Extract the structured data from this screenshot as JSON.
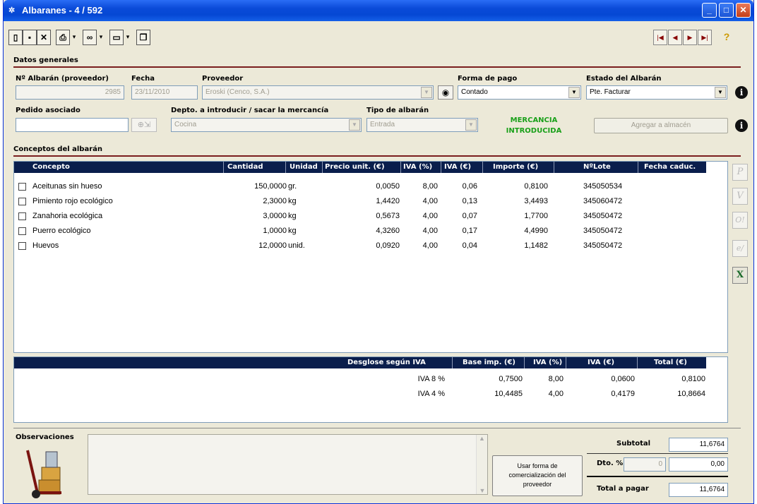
{
  "window": {
    "title": "Albaranes - 4 / 592"
  },
  "sections": {
    "general": "Datos generales",
    "concepts": "Conceptos del albarán"
  },
  "fields": {
    "albaran_label": "Nº Albarán (proveedor)",
    "albaran_value": "2985",
    "fecha_label": "Fecha",
    "fecha_value": "23/11/2010",
    "proveedor_label": "Proveedor",
    "proveedor_value": "Eroski (Cenco, S.A.)",
    "forma_pago_label": "Forma de pago",
    "forma_pago_value": "Contado",
    "estado_label": "Estado del Albarán",
    "estado_value": "Pte. Facturar",
    "pedido_label": "Pedido asociado",
    "pedido_value": "",
    "depto_label": "Depto. a introducir / sacar la mercancía",
    "depto_value": "Cocina",
    "tipo_label": "Tipo de albarán",
    "tipo_value": "Entrada",
    "status_line1": "MERCANCIA",
    "status_line2": "INTRODUCIDA",
    "agregar_button": "Agregar a almacén"
  },
  "concepts": {
    "headers": [
      "Concepto",
      "Cantidad",
      "Unidad",
      "Precio unit. (€)",
      "IVA (%)",
      "IVA (€)",
      "Importe (€)",
      "NºLote",
      "Fecha caduc."
    ],
    "rows": [
      {
        "concepto": "Aceitunas sin hueso",
        "cantidad": "150,0000",
        "unidad": "gr.",
        "precio": "0,0050",
        "iva_pct": "8,00",
        "iva_eur": "0,06",
        "importe": "0,8100",
        "lote": "345050534",
        "caduc": ""
      },
      {
        "concepto": "Pimiento rojo ecológico",
        "cantidad": "2,3000",
        "unidad": "kg",
        "precio": "1,4420",
        "iva_pct": "4,00",
        "iva_eur": "0,13",
        "importe": "3,4493",
        "lote": "345060472",
        "caduc": ""
      },
      {
        "concepto": "Zanahoria ecológica",
        "cantidad": "3,0000",
        "unidad": "kg",
        "precio": "0,5673",
        "iva_pct": "4,00",
        "iva_eur": "0,07",
        "importe": "1,7700",
        "lote": "345050472",
        "caduc": ""
      },
      {
        "concepto": "Puerro ecológico",
        "cantidad": "1,0000",
        "unidad": "kg",
        "precio": "4,3260",
        "iva_pct": "4,00",
        "iva_eur": "0,17",
        "importe": "4,4990",
        "lote": "345050472",
        "caduc": ""
      },
      {
        "concepto": "Huevos",
        "cantidad": "12,0000",
        "unidad": "unid.",
        "precio": "0,0920",
        "iva_pct": "4,00",
        "iva_eur": "0,04",
        "importe": "1,1482",
        "lote": "345050472",
        "caduc": ""
      }
    ]
  },
  "iva_breakdown": {
    "headers": [
      "Desglose según IVA",
      "Base imp. (€)",
      "IVA (%)",
      "IVA (€)",
      "Total (€)"
    ],
    "rows": [
      {
        "label": "IVA 8 %",
        "base": "0,7500",
        "pct": "8,00",
        "iva": "0,0600",
        "total": "0,8100"
      },
      {
        "label": "IVA 4 %",
        "base": "10,4485",
        "pct": "4,00",
        "iva": "0,4179",
        "total": "10,8664"
      }
    ]
  },
  "footer": {
    "observaciones_label": "Observaciones",
    "usar_button": "Usar forma de comercialización del proveedor",
    "subtotal_label": "Subtotal",
    "subtotal_value": "11,6764",
    "dto_label": "Dto. %",
    "dto_pct": "0",
    "dto_value": "0,00",
    "total_label": "Total a pagar",
    "total_value": "11,6764"
  },
  "side_buttons": [
    "P",
    "V",
    "O!",
    "e/",
    "X"
  ]
}
